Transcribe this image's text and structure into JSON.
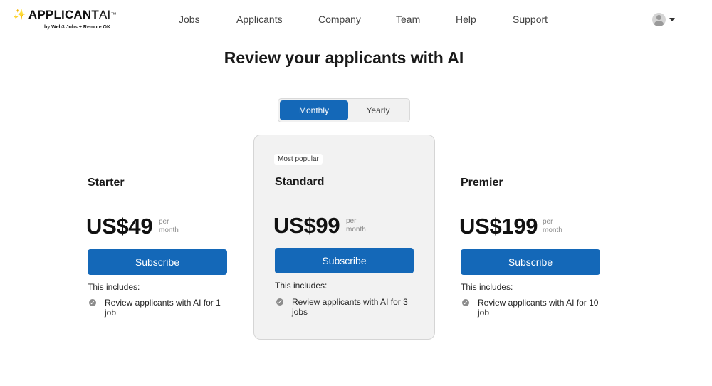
{
  "brand": {
    "name_main": "APPLICANT",
    "name_ai": "AI",
    "superscript": "™",
    "tagline": "by Web3 Jobs + Remote OK"
  },
  "nav": {
    "items": [
      {
        "label": "Jobs"
      },
      {
        "label": "Applicants"
      },
      {
        "label": "Company"
      },
      {
        "label": "Team"
      },
      {
        "label": "Help"
      },
      {
        "label": "Support"
      }
    ]
  },
  "page": {
    "title": "Review your applicants with AI"
  },
  "billing_toggle": {
    "monthly_label": "Monthly",
    "yearly_label": "Yearly",
    "selected": "Monthly"
  },
  "plans": [
    {
      "name": "Starter",
      "price": "US$49",
      "per_line1": "per",
      "per_line2": "month",
      "button_label": "Subscribe",
      "includes_label": "This includes:",
      "feature": "Review applicants with AI for 1 job"
    },
    {
      "badge": "Most popular",
      "name": "Standard",
      "price": "US$99",
      "per_line1": "per",
      "per_line2": "month",
      "button_label": "Subscribe",
      "includes_label": "This includes:",
      "feature": "Review applicants with AI for 3 jobs"
    },
    {
      "name": "Premier",
      "price": "US$199",
      "per_line1": "per",
      "per_line2": "month",
      "button_label": "Subscribe",
      "includes_label": "This includes:",
      "feature": "Review applicants with AI for 10 job"
    }
  ],
  "colors": {
    "accent": "#1468b8",
    "featured_card_bg": "#f2f2f2",
    "sparkle": "#f2b01e"
  }
}
